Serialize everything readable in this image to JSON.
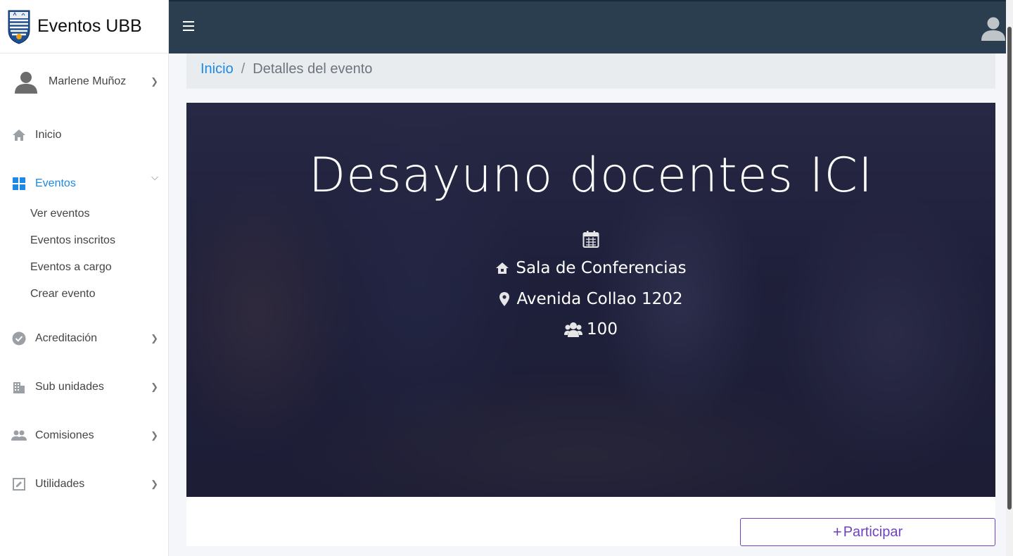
{
  "brand": {
    "title": "Eventos UBB"
  },
  "user": {
    "name": "Marlene Muñoz"
  },
  "sidebar": {
    "items": [
      {
        "label": "Inicio"
      },
      {
        "label": "Eventos"
      },
      {
        "label": "Acreditación"
      },
      {
        "label": "Sub unidades"
      },
      {
        "label": "Comisiones"
      },
      {
        "label": "Utilidades"
      }
    ],
    "eventos_sub": [
      {
        "label": "Ver eventos"
      },
      {
        "label": "Eventos inscritos"
      },
      {
        "label": "Eventos a cargo"
      },
      {
        "label": "Crear evento"
      }
    ]
  },
  "breadcrumb": {
    "home": "Inicio",
    "separator": "/",
    "current": "Detalles del evento"
  },
  "event": {
    "title": "Desayuno docentes ICI",
    "place": "Sala de Conferencias",
    "address": "Avenida Collao 1202",
    "capacity": "100"
  },
  "actions": {
    "participate_plus": "+",
    "participate_label": "Participar"
  },
  "colors": {
    "header": "#2b3e50",
    "accent": "#1e88e5",
    "button": "#6f42c1"
  }
}
